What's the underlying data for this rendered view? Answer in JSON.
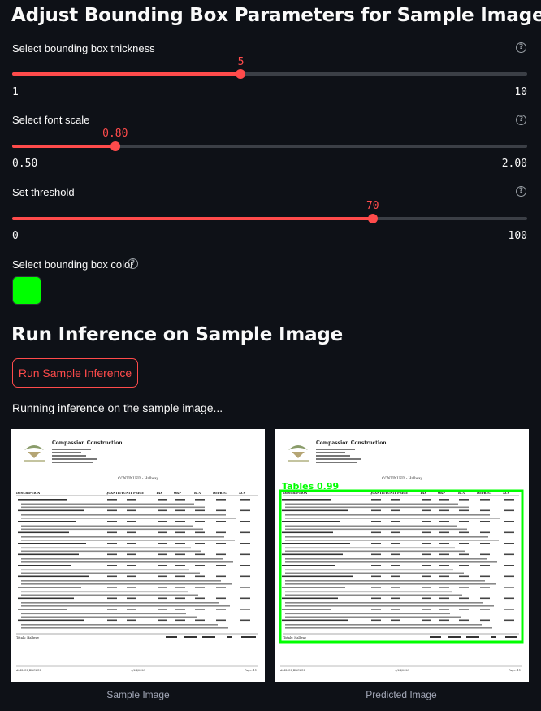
{
  "headings": {
    "adjust": "Adjust Bounding Box Parameters for Sample Image",
    "run": "Run Inference on Sample Image"
  },
  "sliders": {
    "thickness": {
      "label": "Select bounding box thickness",
      "value": "5",
      "min": "1",
      "max": "10",
      "fraction": 0.444
    },
    "font_scale": {
      "label": "Select font scale",
      "value": "0.80",
      "min": "0.50",
      "max": "2.00",
      "fraction": 0.2
    },
    "threshold": {
      "label": "Set threshold",
      "value": "70",
      "min": "0",
      "max": "100",
      "fraction": 0.7
    }
  },
  "color_picker": {
    "label": "Select bounding box color",
    "color": "#00ff00"
  },
  "run_button": {
    "label": "Run Sample Inference"
  },
  "status": {
    "text": "Running inference on the sample image..."
  },
  "images": {
    "sample": {
      "caption": "Sample Image",
      "company": "Compassion Construction",
      "section": "CONTINUED - Hallway",
      "columns": [
        "DESCRIPTION",
        "QUANTITY",
        "UNIT PRICE",
        "TAX",
        "O&P",
        "RCV",
        "DEPREC.",
        "ACV"
      ],
      "totals": "Totals: Hallway",
      "footer_left": "ALISON_BROWN",
      "footer_mid": "4/24/2023",
      "footer_right": "Page: 11"
    },
    "predicted": {
      "caption": "Predicted Image",
      "detection_label": "Tables 0.99",
      "company": "Compassion Construction",
      "section": "CONTINUED - Hallway",
      "columns": [
        "DESCRIPTION",
        "QUANTITY",
        "UNIT PRICE",
        "TAX",
        "O&P",
        "RCV",
        "DEPREC.",
        "ACV"
      ],
      "totals": "Totals: Hallway",
      "footer_left": "ALISON_BROWN",
      "footer_mid": "4/24/2023",
      "footer_right": "Page: 11"
    }
  },
  "colors": {
    "accent": "#ff4b4b",
    "background": "#0e1117",
    "track": "#3b3f46",
    "bbox": "#00ff00"
  },
  "icons": {
    "help": "question-circle-icon"
  }
}
